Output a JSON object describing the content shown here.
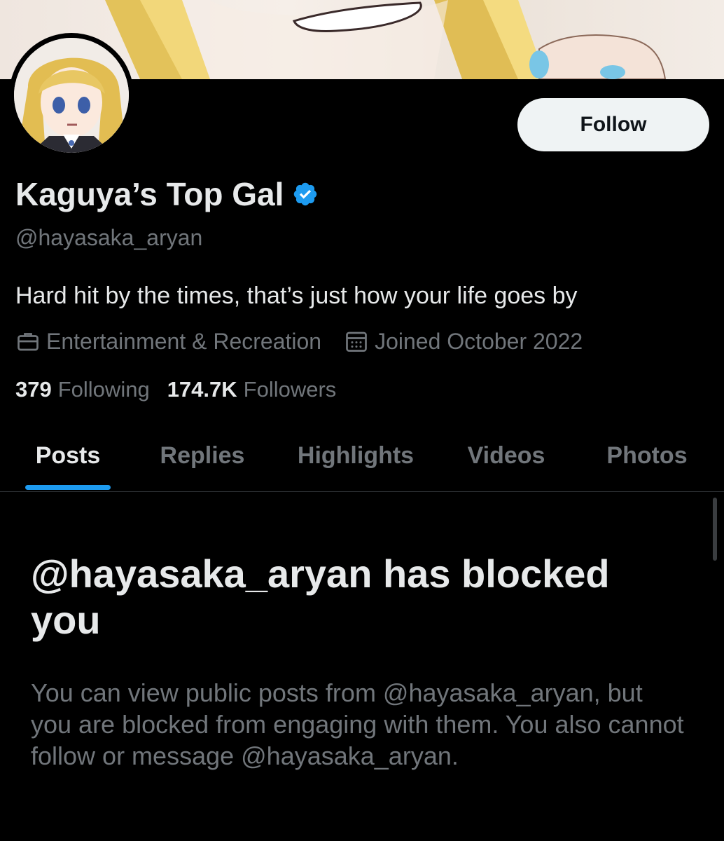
{
  "colors": {
    "background": "#000000",
    "primary_text": "#e7e9ea",
    "secondary_text": "#71767b",
    "accent": "#1d9bf0",
    "follow_button_bg": "#eff3f4"
  },
  "profile": {
    "display_name": "Kaguya’s Top Gal",
    "verified_icon": "verified-badge-icon",
    "handle": "@hayasaka_aryan",
    "bio": "Hard hit by the times, that’s just how your life goes by",
    "category_icon": "briefcase-icon",
    "category": "Entertainment & Recreation",
    "joined_icon": "calendar-icon",
    "joined": "Joined October 2022",
    "following_count": "379",
    "following_label": "Following",
    "followers_count": "174.7K",
    "followers_label": "Followers"
  },
  "actions": {
    "follow_label": "Follow"
  },
  "tabs": [
    {
      "label": "Posts",
      "active": true
    },
    {
      "label": "Replies",
      "active": false
    },
    {
      "label": "Highlights",
      "active": false
    },
    {
      "label": "Videos",
      "active": false
    },
    {
      "label": "Photos",
      "active": false
    }
  ],
  "blocked": {
    "title": "@hayasaka_aryan has blocked you",
    "description": "You can view public posts from @hayasaka_aryan, but you are blocked from engaging with them. You also cannot follow or message @hayasaka_aryan."
  }
}
